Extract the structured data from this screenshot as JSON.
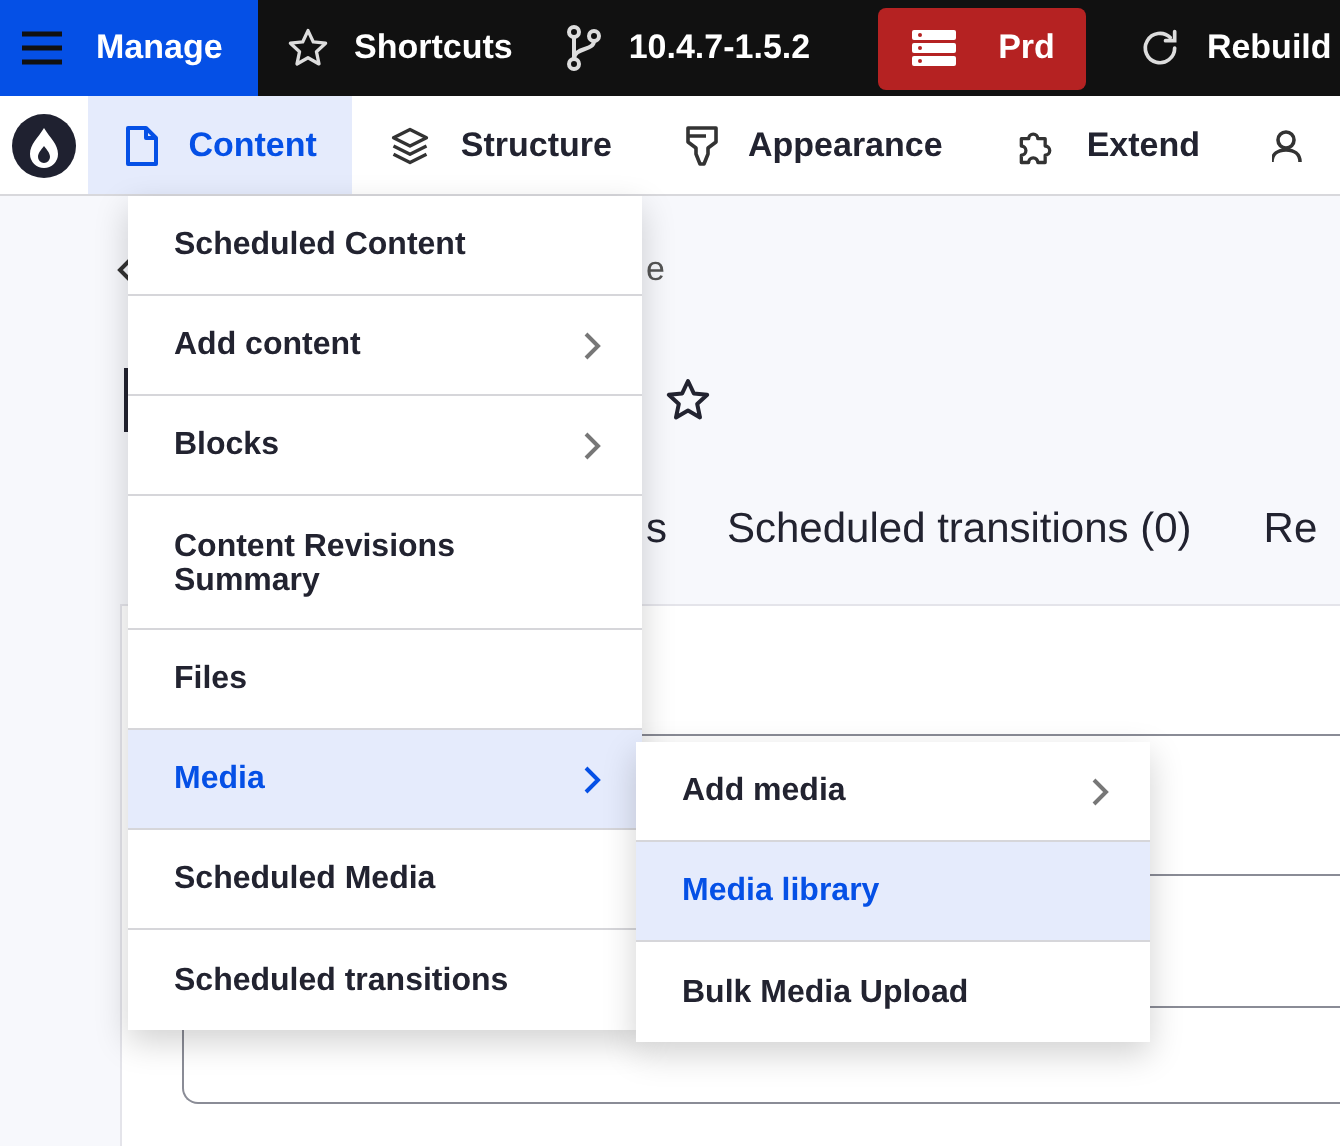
{
  "toolbar": {
    "items": [
      {
        "kind": "manage",
        "label": "Manage"
      },
      {
        "kind": "shortcuts",
        "label": "Shortcuts"
      },
      {
        "kind": "branch",
        "label": "10.4.7-1.5.2"
      },
      {
        "kind": "environment",
        "label": "Prd"
      },
      {
        "kind": "rebuild",
        "label": "Rebuild"
      }
    ]
  },
  "nav": {
    "items": [
      {
        "kind": "content",
        "label": "Content",
        "selected": true
      },
      {
        "kind": "structure",
        "label": "Structure",
        "selected": false
      },
      {
        "kind": "appearance",
        "label": "Appearance",
        "selected": false
      },
      {
        "kind": "extend",
        "label": "Extend",
        "selected": false
      },
      {
        "kind": "people",
        "selected": false
      }
    ]
  },
  "page": {
    "breadcrumb": "e",
    "tabs": [
      "s",
      "Scheduled transitions (0)",
      "Re"
    ]
  },
  "menu": {
    "items": [
      {
        "label": "Scheduled Content",
        "has_submenu": false,
        "selected": false
      },
      {
        "label": "Add content",
        "has_submenu": true,
        "selected": false
      },
      {
        "label": "Blocks",
        "has_submenu": true,
        "selected": false
      },
      {
        "label": "Content Revisions Summary",
        "has_submenu": false,
        "selected": false
      },
      {
        "label": "Files",
        "has_submenu": false,
        "selected": false
      },
      {
        "label": "Media",
        "has_submenu": true,
        "selected": true
      },
      {
        "label": "Scheduled Media",
        "has_submenu": false,
        "selected": false
      },
      {
        "label": "Scheduled transitions",
        "has_submenu": false,
        "selected": false
      }
    ]
  },
  "submenu": {
    "items": [
      {
        "label": "Add media",
        "has_submenu": true,
        "selected": false
      },
      {
        "label": "Media library",
        "has_submenu": false,
        "selected": true
      },
      {
        "label": "Bulk Media Upload",
        "has_submenu": false,
        "selected": false
      }
    ]
  }
}
